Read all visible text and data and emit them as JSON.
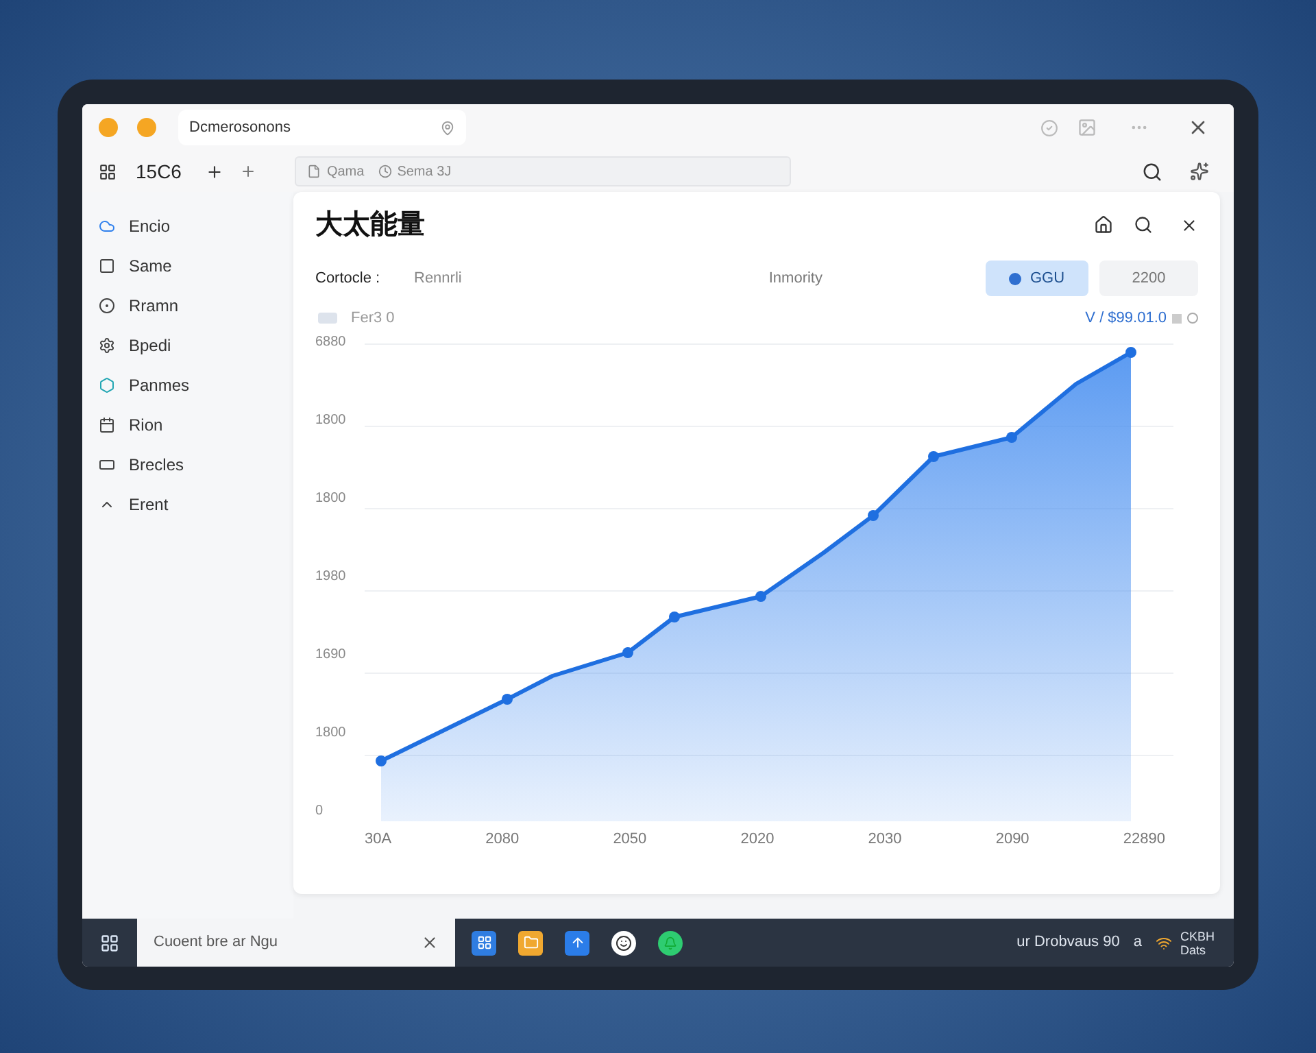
{
  "browser": {
    "tab_title": "Dcmerosonons",
    "counter": "15C6",
    "address_items": [
      "Qama",
      "Sema 3J"
    ]
  },
  "sidebar": {
    "items": [
      {
        "label": "Encio"
      },
      {
        "label": "Same"
      },
      {
        "label": "Rramn"
      },
      {
        "label": "Bpedi"
      },
      {
        "label": "Panmes"
      },
      {
        "label": "Rion"
      },
      {
        "label": "Brecles"
      },
      {
        "label": "Erent"
      }
    ]
  },
  "panel": {
    "title": "大太能量",
    "filter_label": "Cortocle :",
    "filter_value": "Rennrli",
    "column_label": "Inmority",
    "buttons": [
      {
        "label": "GGU",
        "selected": true
      },
      {
        "label": "2200",
        "selected": false
      }
    ],
    "legend": "Fer3 0",
    "total": "V / $99.01.0",
    "chart": {
      "y_labels": [
        "6880",
        "1800",
        "1800",
        "1980",
        "1690",
        "1800",
        "0"
      ],
      "x_labels": [
        "30A",
        "2080",
        "2050",
        "2020",
        "2030",
        "2090",
        "22890"
      ]
    }
  },
  "taskbar": {
    "search_value": "Cuoent bre ar Ngu",
    "status_text": "ur Drobvaus 90",
    "indicator": "a",
    "clock_lines": [
      "CKBH",
      "Dats"
    ]
  }
}
